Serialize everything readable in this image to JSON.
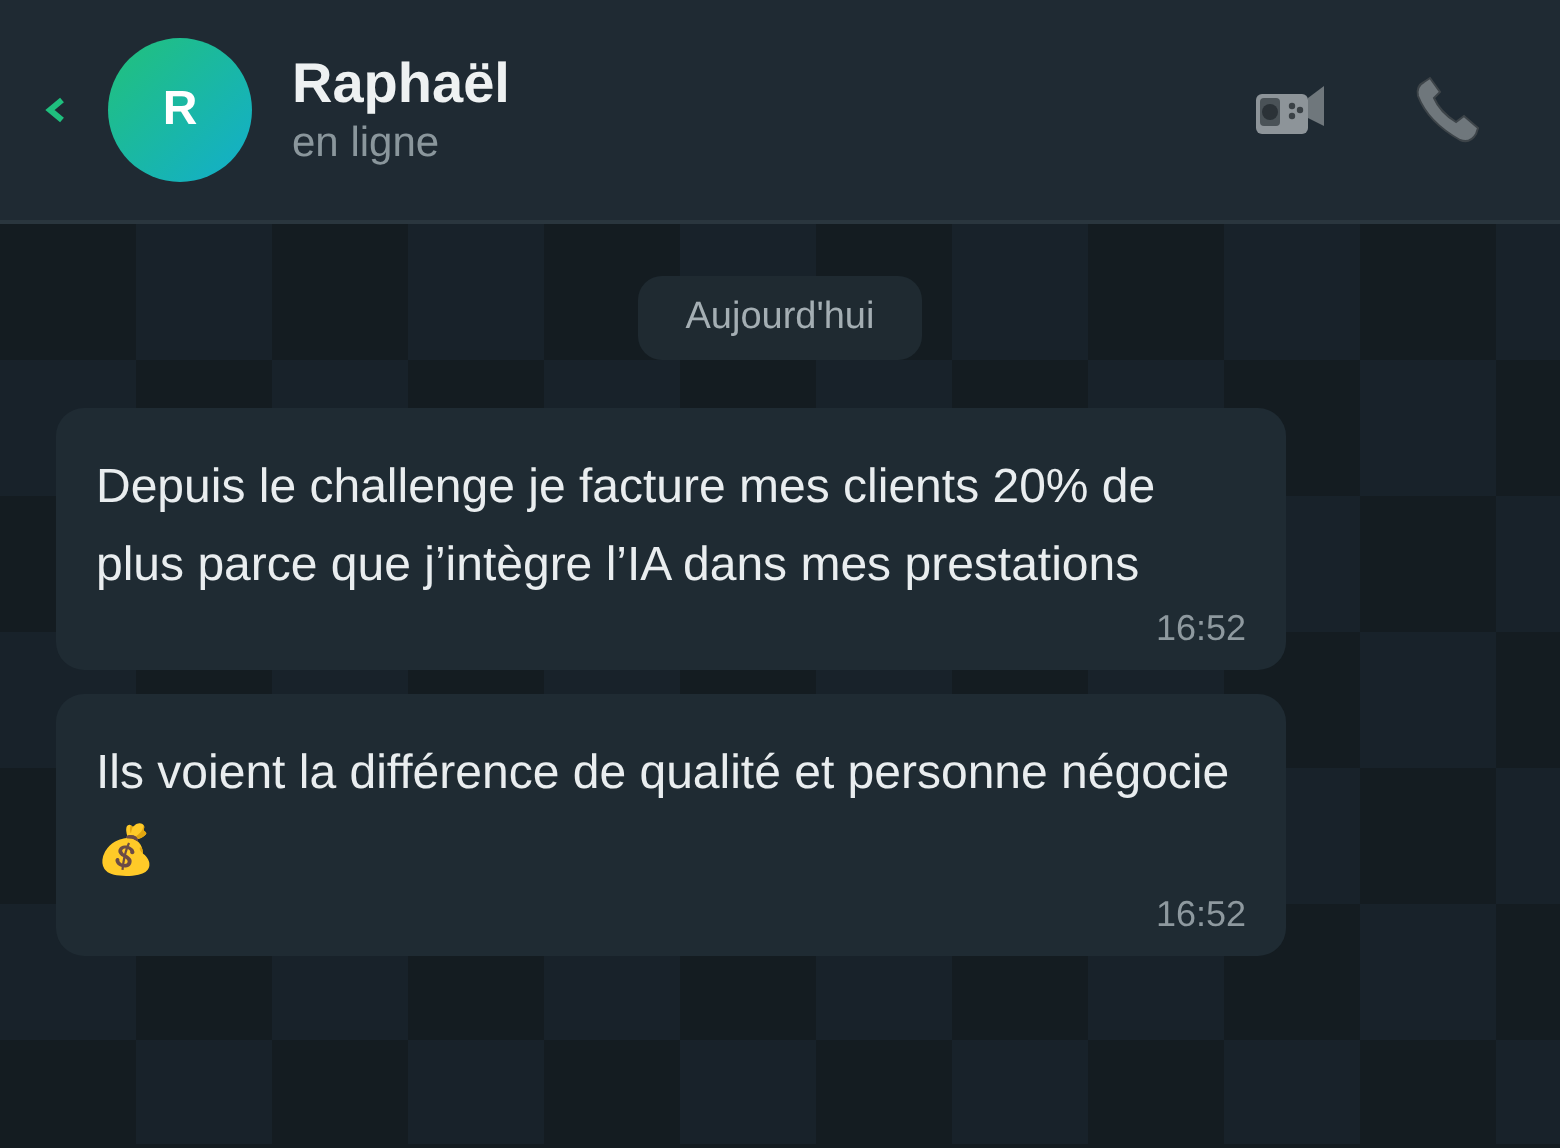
{
  "contact": {
    "initial": "R",
    "name": "Raphaël",
    "status": "en ligne"
  },
  "date_label": "Aujourd'hui",
  "messages": [
    {
      "text": "Depuis le challenge je facture mes clients 20% de plus parce que j’intègre l’IA dans mes prestations",
      "time": "16:52"
    },
    {
      "text": "Ils voient la différence de qualité et personne négocie 💰",
      "time": "16:52"
    }
  ]
}
